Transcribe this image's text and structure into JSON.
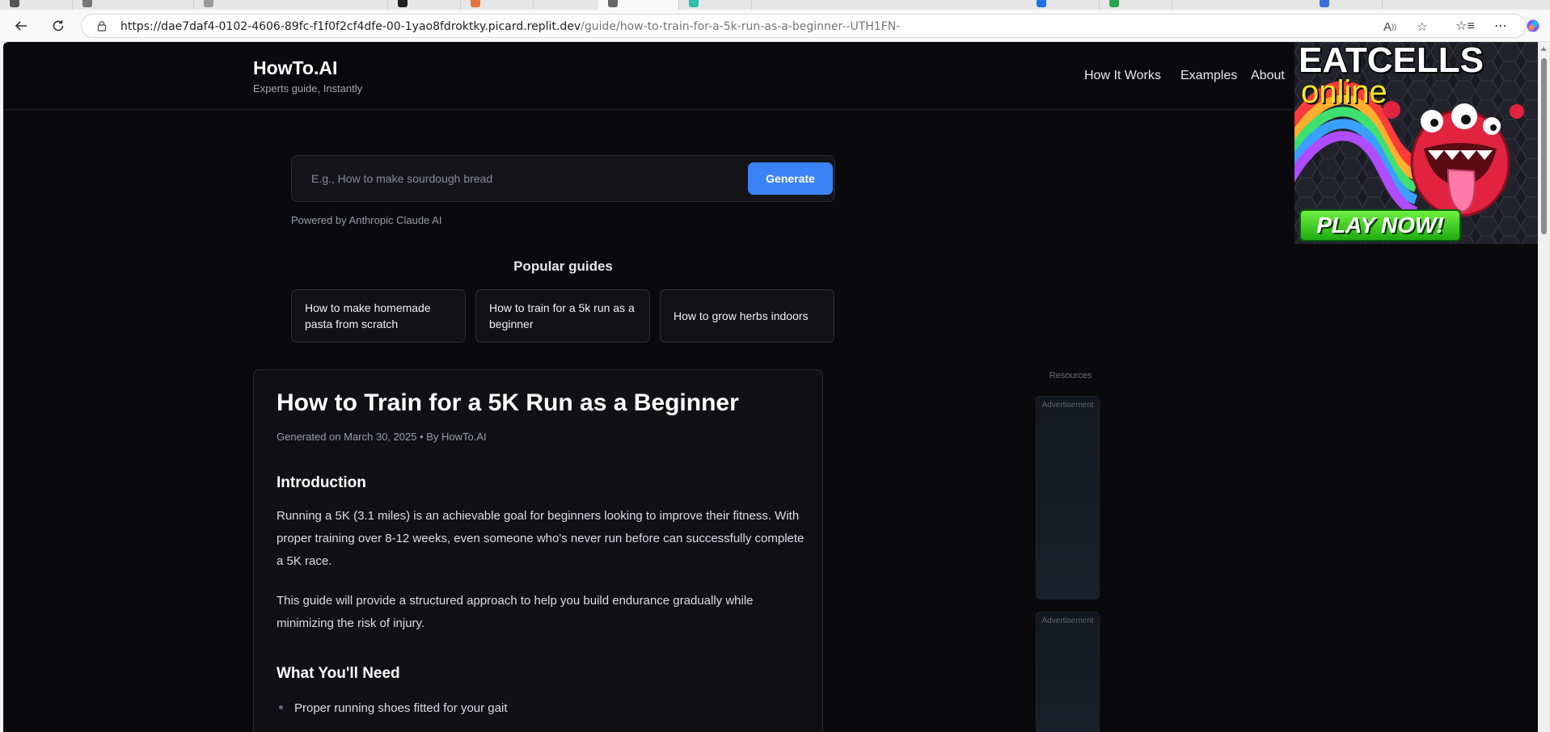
{
  "browser": {
    "url_main": "https://dae7daf4-0102-4606-89fc-f1f0f2cf4dfe-00-1yao8fdroktky.picard.replit.dev",
    "url_path": "/guide/how-to-train-for-a-5k-run-as-a-beginner--UTH1FN-"
  },
  "site": {
    "logo": "HowTo.AI",
    "tagline": "Experts guide, Instantly",
    "nav": [
      "How It Works",
      "Examples",
      "About"
    ]
  },
  "search": {
    "placeholder": "E.g., How to make sourdough bread",
    "button_label": "Generate",
    "powered_by": "Powered by Anthropic Claude AI"
  },
  "popular": {
    "title": "Popular guides",
    "items": [
      "How to make homemade pasta from scratch",
      "How to train for a 5k run as a beginner",
      "How to grow herbs indoors"
    ]
  },
  "article": {
    "title": "How to Train for a 5K Run as a Beginner",
    "meta": "Generated on March 30, 2025  •  By HowTo.AI",
    "sections": [
      {
        "heading": "Introduction",
        "paragraphs": [
          "Running a 5K (3.1 miles) is an achievable goal for beginners looking to improve their fitness. With proper training over 8-12 weeks, even someone who's never run before can successfully complete a 5K race.",
          "This guide will provide a structured approach to help you build endurance gradually while minimizing the risk of injury."
        ]
      },
      {
        "heading": "What You'll Need",
        "items": [
          "Proper running shoes fitted for your gait"
        ]
      }
    ]
  },
  "sidebar": {
    "resources_label": "Resources",
    "ad_label": "Advertisement"
  },
  "game_ad": {
    "title": "EATCELLS",
    "subtitle": "online",
    "cta": "PLAY NOW!"
  }
}
